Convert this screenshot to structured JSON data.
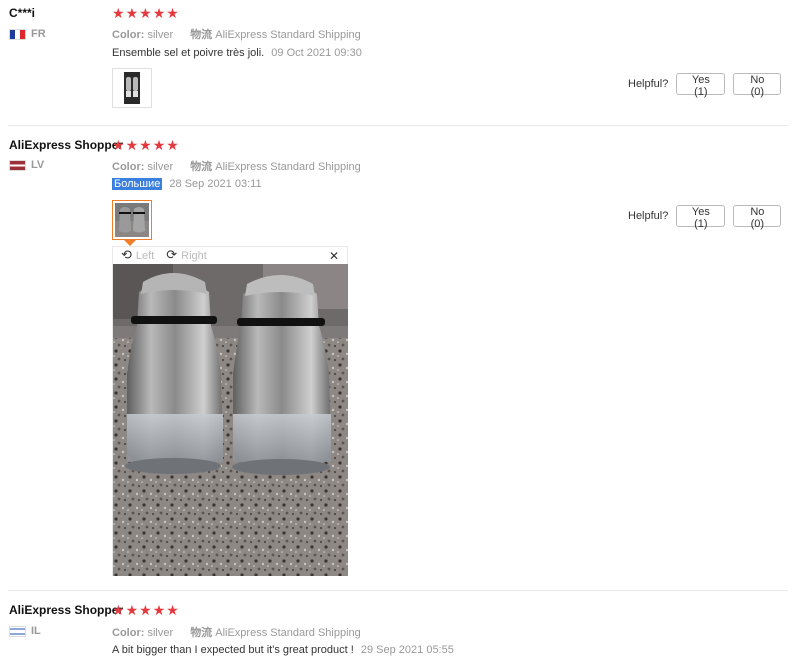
{
  "reviews": [
    {
      "user": "C***i",
      "country": "FR",
      "color_label": "Color:",
      "color_value": "silver",
      "ship_label": "物流",
      "shipping": "AliExpress Standard Shipping",
      "feedback": "Ensemble sel et poivre très joli.",
      "date": "09 Oct 2021 09:30",
      "stars": 5,
      "helpful_label": "Helpful?",
      "yes_label": "Yes (1)",
      "no_label": "No (0)"
    },
    {
      "user": "AliExpress Shopper",
      "country": "LV",
      "color_label": "Color:",
      "color_value": "silver",
      "ship_label": "物流",
      "shipping": "AliExpress Standard Shipping",
      "feedback": "Большие",
      "date": "28 Sep 2021 03:11",
      "stars": 5,
      "helpful_label": "Helpful?",
      "yes_label": "Yes (1)",
      "no_label": "No (0)",
      "viewer": {
        "rotate_left": "Left",
        "rotate_right": "Right"
      }
    },
    {
      "user": "AliExpress Shopper",
      "country": "IL",
      "color_label": "Color:",
      "color_value": "silver",
      "ship_label": "物流",
      "shipping": "AliExpress Standard Shipping",
      "feedback": "A bit bigger than I expected but it's great product !",
      "date": "29 Sep 2021 05:55",
      "stars": 5
    }
  ],
  "colors": {
    "star": "#e43a3f",
    "accent": "#f07e28",
    "selection": "#3b7fde"
  },
  "icons": {
    "star": "star-icon",
    "rotate_left": "rotate-left-icon",
    "rotate_right": "rotate-right-icon",
    "close": "close-icon"
  }
}
